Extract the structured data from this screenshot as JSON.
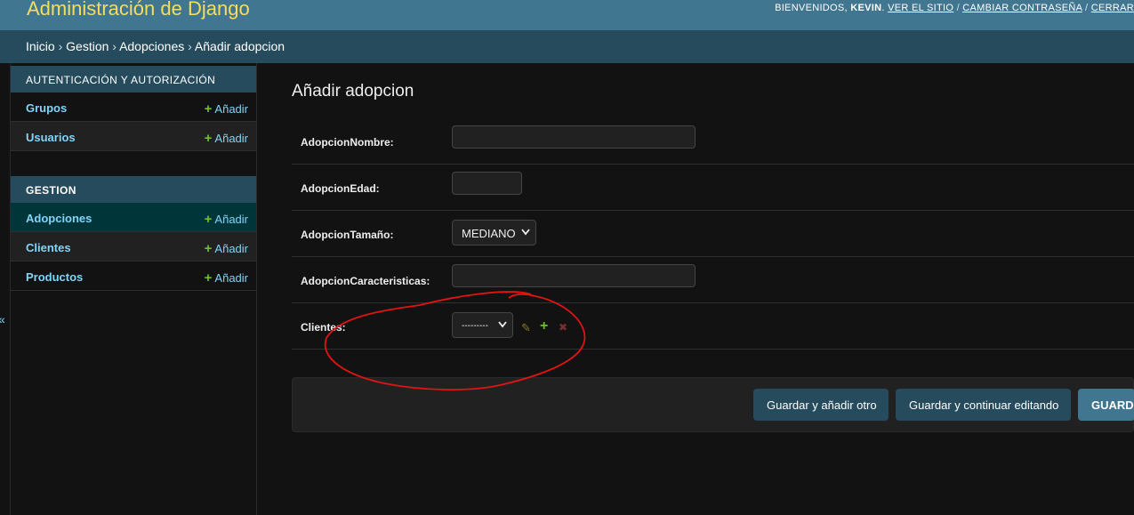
{
  "header": {
    "site_title": "Administración de Django",
    "welcome": "BIENVENIDOS,",
    "username": "KEVIN",
    "view_site": "VER EL SITIO",
    "change_password": "CAMBIAR CONTRASEÑA",
    "logout": "CERRAR"
  },
  "breadcrumbs": {
    "home": "Inicio",
    "app": "Gestion",
    "model": "Adopciones",
    "current": "Añadir adopcion"
  },
  "sidebar": {
    "modules": [
      {
        "caption": "Autenticación y autorización",
        "models": [
          {
            "name": "Grupos",
            "add": "Añadir"
          },
          {
            "name": "Usuarios",
            "add": "Añadir"
          }
        ]
      },
      {
        "caption": "Gestion",
        "models": [
          {
            "name": "Adopciones",
            "add": "Añadir"
          },
          {
            "name": "Clientes",
            "add": "Añadir"
          },
          {
            "name": "Productos",
            "add": "Añadir"
          }
        ]
      }
    ],
    "toggle_icon": "«"
  },
  "main": {
    "title": "Añadir adopcion",
    "fields": [
      {
        "label": "AdopcionNombre:",
        "value": ""
      },
      {
        "label": "AdopcionEdad:",
        "value": ""
      },
      {
        "label": "AdopcionTamaño:",
        "value": "MEDIANO"
      },
      {
        "label": "AdopcionCaracteristicas:",
        "value": ""
      },
      {
        "label": "Clientes:",
        "value": "---------"
      }
    ],
    "related_icons": {
      "edit": "✎",
      "add": "+",
      "delete": "✖"
    },
    "buttons": {
      "save_add_another": "Guardar y añadir otro",
      "save_continue": "Guardar y continuar editando",
      "save": "GUARDAR"
    }
  },
  "colors": {
    "header_bg": "#417690",
    "site_title": "#f5dd5d",
    "breadcrumb_bg": "#264b5d",
    "link": "#81d4fa",
    "add_plus": "#70bf2b",
    "annotation": "#e01414"
  }
}
